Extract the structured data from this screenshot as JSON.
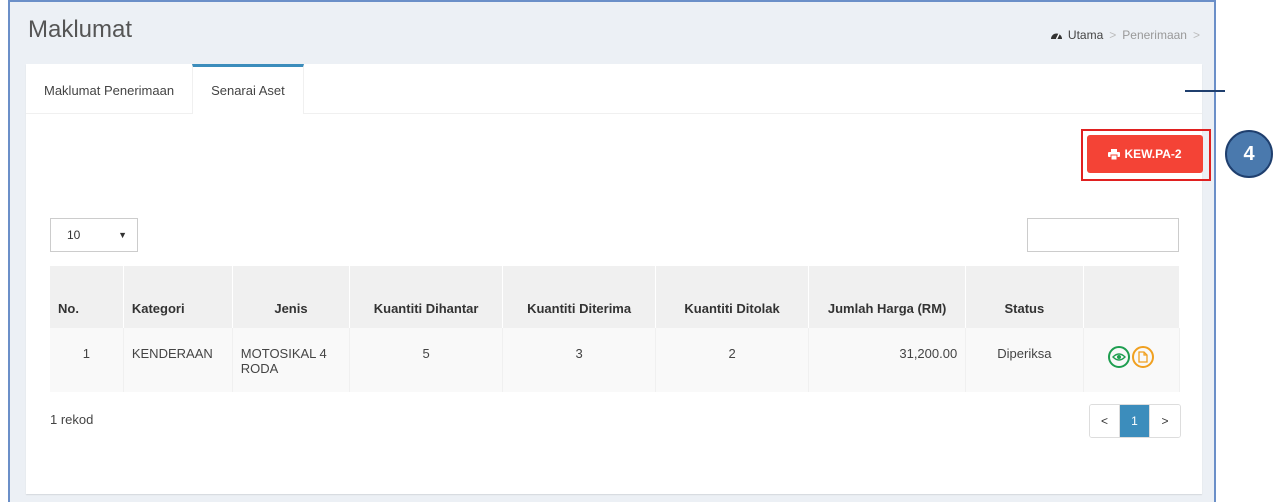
{
  "header": {
    "title": "Maklumat",
    "breadcrumb": {
      "home": "Utama",
      "sep1": ">",
      "current": "Penerimaan",
      "sep2": ">"
    }
  },
  "tabs": [
    {
      "label": "Maklumat Penerimaan",
      "active": false
    },
    {
      "label": "Senarai Aset",
      "active": true
    }
  ],
  "toolbar": {
    "print_label": "KEW.PA-2",
    "callout_number": "4"
  },
  "table_controls": {
    "page_length": "10",
    "search_value": ""
  },
  "table": {
    "headers": [
      "No.",
      "Kategori",
      "Jenis",
      "Kuantiti Dihantar",
      "Kuantiti Diterima",
      "Kuantiti Ditolak",
      "Jumlah Harga (RM)",
      "Status",
      ""
    ],
    "rows": [
      {
        "no": "1",
        "kategori": "KENDERAAN",
        "jenis": "MOTOSIKAL 4 RODA",
        "dihantar": "5",
        "diterima": "3",
        "ditolak": "2",
        "harga": "31,200.00",
        "status": "Diperiksa"
      }
    ]
  },
  "footer": {
    "count": "1 rekod"
  },
  "pagination": {
    "prev": "<",
    "current": "1",
    "next": ">"
  },
  "colors": {
    "accent": "#3c8dbc",
    "danger": "#f44336",
    "view": "#1e9e50",
    "doc": "#f0a020",
    "callout": "#4a79ad"
  }
}
